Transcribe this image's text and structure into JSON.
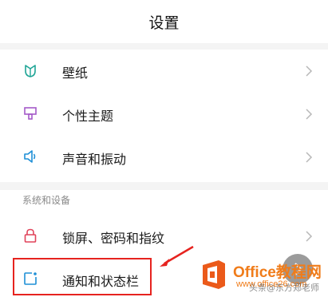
{
  "header": {
    "title": "设置"
  },
  "items": [
    {
      "label": "壁纸",
      "icon": "wallpaper-icon",
      "color": "#1fa596"
    },
    {
      "label": "个性主题",
      "icon": "theme-icon",
      "color": "#a45ac8"
    },
    {
      "label": "声音和振动",
      "icon": "sound-icon",
      "color": "#1e8fd6"
    }
  ],
  "section": {
    "title": "系统和设备",
    "items": [
      {
        "label": "锁屏、密码和指纹",
        "icon": "lock-icon",
        "color": "#e0435a"
      },
      {
        "label": "通知和状态栏",
        "icon": "notification-icon",
        "color": "#1e8fd6"
      }
    ]
  },
  "watermark": {
    "brand": "Office教程网",
    "site": "www.office26.com",
    "author": "头条@东方郑老师",
    "brand_color": "#f07c1a"
  },
  "highlight_color": "#e6231f"
}
